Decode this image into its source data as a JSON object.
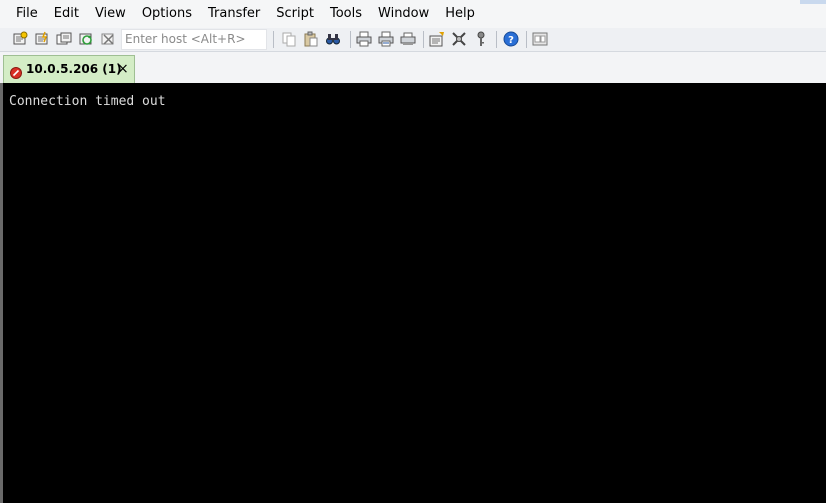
{
  "menu": {
    "items": [
      "File",
      "Edit",
      "View",
      "Options",
      "Transfer",
      "Script",
      "Tools",
      "Window",
      "Help"
    ]
  },
  "toolbar": {
    "icons": [
      "connect-icon",
      "quick-connect-icon",
      "connect-in-tab-icon",
      "reconnect-icon",
      "disconnect-icon",
      "copy-icon",
      "paste-icon",
      "find-icon",
      "print-icon",
      "print-selection-icon",
      "print-setup-icon",
      "session-options-icon",
      "global-options-icon",
      "keymap-icon",
      "help-icon",
      "sftp-icon"
    ],
    "quick_connect_placeholder": "Enter host <Alt+R>"
  },
  "tabs": [
    {
      "label": "10.0.5.206 (1)",
      "close": "×",
      "status": "disconnected"
    }
  ],
  "terminal": {
    "lines": [
      "Connection timed out"
    ]
  },
  "colors": {
    "tab_background": "#d4edc6",
    "terminal_background": "#000000",
    "terminal_text": "#dcdcdc",
    "disconnected_indicator": "#d93025"
  }
}
